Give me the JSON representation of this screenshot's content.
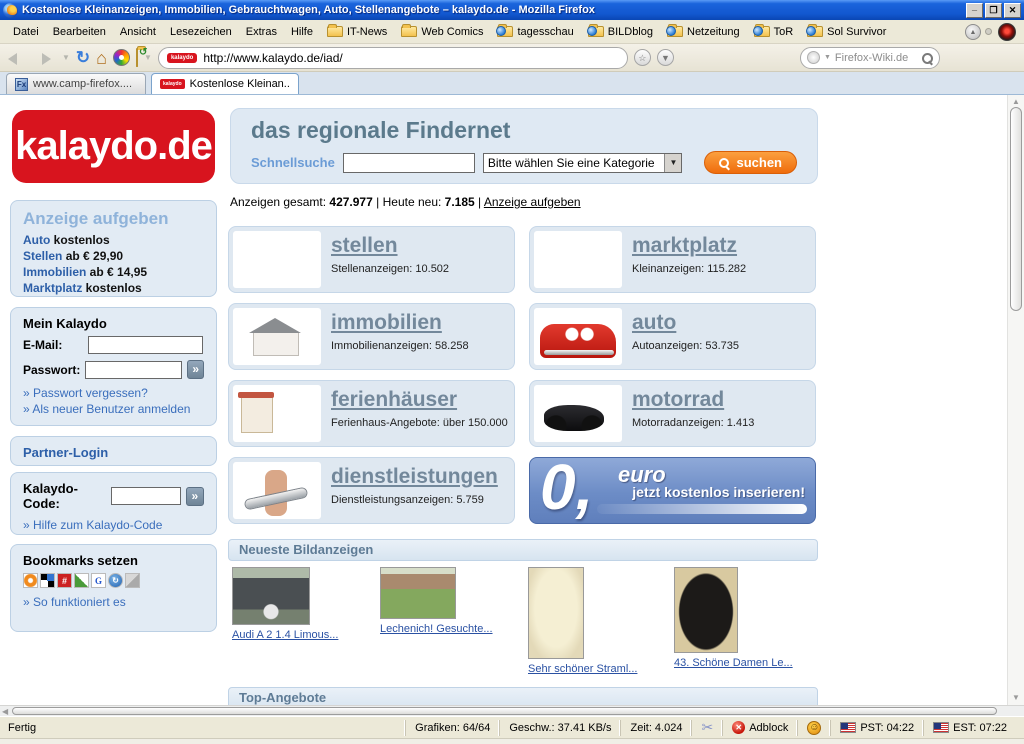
{
  "window": {
    "title": "Kostenlose Kleinanzeigen, Immobilien, Gebrauchtwagen, Auto, Stellenangebote – kalaydo.de - Mozilla Firefox"
  },
  "menubar": {
    "menus": [
      {
        "label": "Datei"
      },
      {
        "label": "Bearbeiten"
      },
      {
        "label": "Ansicht"
      },
      {
        "label": "Lesezeichen"
      },
      {
        "label": "Extras"
      },
      {
        "label": "Hilfe"
      }
    ],
    "bookmarks": [
      {
        "label": "IT-News"
      },
      {
        "label": "Web Comics"
      },
      {
        "label": "tagesschau"
      },
      {
        "label": "BILDblog"
      },
      {
        "label": "Netzeitung"
      },
      {
        "label": "ToR"
      },
      {
        "label": "Sol Survivor"
      }
    ]
  },
  "navbar": {
    "url": "http://www.kalaydo.de/iad/",
    "favicon_text": "kalaydo",
    "search_value": "Firefox-Wiki.de"
  },
  "tabs": [
    {
      "label": "www.camp-firefox...."
    },
    {
      "label": "Kostenlose Kleinan..."
    }
  ],
  "page": {
    "logo": "kalaydo.de",
    "tagline": "das regionale Findernet",
    "quicksearch": {
      "label": "Schnellsuche",
      "category": "Bitte wählen Sie eine Kategorie",
      "button": "suchen"
    },
    "stats": {
      "total_label": "Anzeigen gesamt:",
      "total": "427.977",
      "sep1": "|",
      "today_label": "Heute neu:",
      "today": "7.185",
      "sep2": "|",
      "post_link": "Anzeige aufgeben"
    },
    "sidebar": {
      "promo": {
        "title": "Anzeige aufgeben",
        "items": [
          {
            "name": "Auto",
            "price": " kostenlos"
          },
          {
            "name": "Stellen",
            "price": " ab € 29,90"
          },
          {
            "name": "Immobilien",
            "price": " ab € 14,95"
          },
          {
            "name": "Marktplatz",
            "price": " kostenlos"
          }
        ]
      },
      "login": {
        "title": "Mein Kalaydo",
        "email_label": "E-Mail:",
        "password_label": "Passwort:",
        "submit": "»",
        "links": [
          {
            "label": "Passwort vergessen?"
          },
          {
            "label": "Als neuer Benutzer anmelden"
          }
        ]
      },
      "partner": {
        "title": "Partner-Login"
      },
      "code": {
        "label": "Kalaydo-Code:",
        "submit": "»",
        "link": "Hilfe zum Kalaydo-Code"
      },
      "bookmarks": {
        "title": "Bookmarks setzen",
        "link": "So funktioniert es"
      }
    },
    "categories": [
      {
        "title": "stellen",
        "info": "Stellenanzeigen:  10.502"
      },
      {
        "title": "marktplatz",
        "info": "Kleinanzeigen:  115.282"
      },
      {
        "title": "immobilien",
        "info": "Immobilienanzeigen:  58.258"
      },
      {
        "title": "auto",
        "info": "Autoanzeigen:  53.735"
      },
      {
        "title": "ferienhäuser",
        "info": "Ferienhaus-Angebote:  über 150.000"
      },
      {
        "title": "motorrad",
        "info": "Motorradanzeigen:  1.413"
      },
      {
        "title": "dienstleistungen",
        "info": "Dienstleistungsanzeigen:  5.759"
      }
    ],
    "banner": {
      "zero": "0,",
      "euro": "euro",
      "text": "jetzt kostenlos inserieren!"
    },
    "sections": {
      "newest": "Neueste Bildanzeigen",
      "top": "Top-Angebote"
    },
    "thumbnails": [
      {
        "caption": "Audi A 2 1.4 Limous..."
      },
      {
        "caption": "Lechenich! Gesuchte..."
      },
      {
        "caption": "Sehr schöner Straml..."
      },
      {
        "caption": "43. Schöne Damen Le..."
      }
    ]
  },
  "statusbar": {
    "status": "Fertig",
    "grafiken": "Grafiken: 64/64",
    "geschw": "Geschw.: 37.41 KB/s",
    "zeit": "Zeit: 4.024",
    "adblock": "Adblock",
    "pst": "PST: 04:22",
    "est": "EST: 07:22"
  },
  "colors": {
    "kalaydo_red": "#d8141e",
    "accent_orange": "#ef6c0c",
    "link_blue": "#3a6ebc",
    "banner_blue": "#6c8cc6"
  }
}
